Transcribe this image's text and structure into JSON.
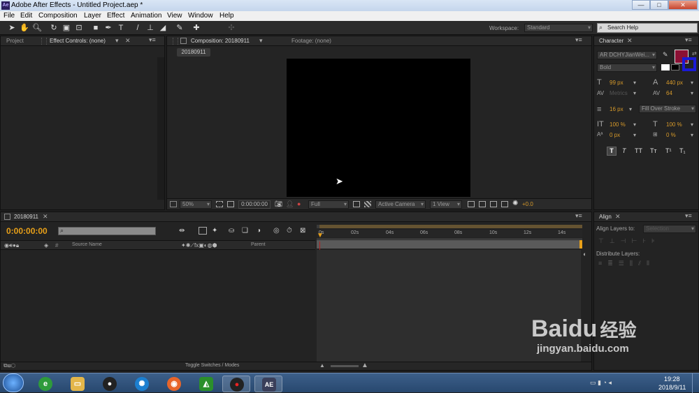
{
  "window": {
    "title": "Adobe After Effects - Untitled Project.aep *",
    "app_badge": "Ae"
  },
  "menu": [
    "File",
    "Edit",
    "Composition",
    "Layer",
    "Effect",
    "Animation",
    "View",
    "Window",
    "Help"
  ],
  "toolbar": {
    "workspace_label": "Workspace:",
    "workspace_value": "Standard",
    "search_placeholder": "Search Help"
  },
  "project_panel": {
    "tab_project": "Project",
    "tab_effect_controls": "Effect Controls: (none)"
  },
  "composition_panel": {
    "tab_composition": "Composition: 20180911",
    "tab_footage": "Footage: (none)",
    "comp_chip": "20180911",
    "zoom": "50%",
    "timecode": "0:00:00:00",
    "resolution": "Full",
    "camera": "Active Camera",
    "views": "1 View",
    "exposure": "+0.0"
  },
  "character_panel": {
    "tab": "Character",
    "font_family": "AR DCHYJianWei...",
    "font_style": "Bold",
    "font_size": "99 px",
    "leading": "440 px",
    "kerning": "Metrics",
    "tracking": "64",
    "stroke_width": "16 px",
    "stroke_mode": "Fill Over Stroke",
    "vert_scale": "100 %",
    "horiz_scale": "100 %",
    "baseline_shift": "0 px",
    "tsume": "0 %",
    "style_buttons": [
      "T",
      "T",
      "TT",
      "Tт",
      "T¹",
      "T₁"
    ],
    "fill_color": "#8b1034",
    "stroke_color": "#1a1ad6"
  },
  "timeline": {
    "tab": "20180911",
    "timecode": "0:00:00:00",
    "col_source_name": "Source Name",
    "col_parent": "Parent",
    "ruler_labels": [
      "0s",
      "02s",
      "04s",
      "06s",
      "08s",
      "10s",
      "12s",
      "14s"
    ],
    "toggle_label": "Toggle Switches / Modes"
  },
  "align_panel": {
    "tab": "Align",
    "align_layers_to": "Align Layers to:",
    "align_target": "Selection",
    "distribute_layers": "Distribute Layers:"
  },
  "taskbar": {
    "time": "19:28",
    "date": "2018/9/11",
    "apps": [
      "Start",
      "Browser",
      "Explorer",
      "QQ",
      "Player",
      "Firefox",
      "App",
      "Recorder",
      "After Effects"
    ],
    "ae_label": "AE"
  },
  "watermark": {
    "brand": "Baidu",
    "brand_cn": "经验",
    "url": "jingyan.baidu.com"
  }
}
